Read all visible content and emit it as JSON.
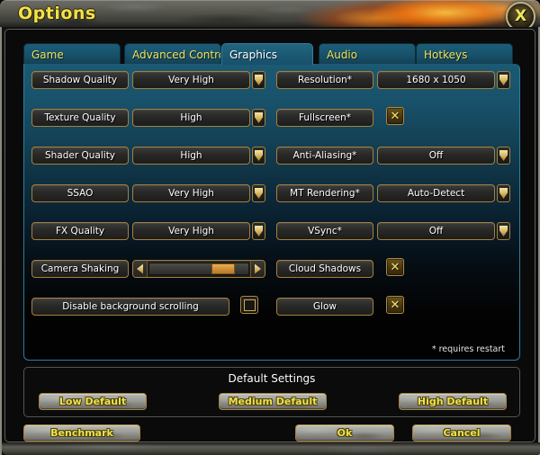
{
  "window": {
    "title": "Options",
    "close_label": "X",
    "close_icon": "close-x-icon"
  },
  "tabs": [
    {
      "label": "Game",
      "active": false
    },
    {
      "label": "Advanced Controls",
      "active": false
    },
    {
      "label": "Graphics",
      "active": true
    },
    {
      "label": "Audio",
      "active": false
    },
    {
      "label": "Hotkeys",
      "active": false
    }
  ],
  "settings": {
    "left_column": [
      {
        "label": "Shadow Quality",
        "control": "dropdown",
        "value": "Very High"
      },
      {
        "label": "Texture Quality",
        "control": "dropdown",
        "value": "High"
      },
      {
        "label": "Shader Quality",
        "control": "dropdown",
        "value": "High"
      },
      {
        "label": "SSAO",
        "control": "dropdown",
        "value": "Very High"
      },
      {
        "label": "FX Quality",
        "control": "dropdown",
        "value": "Very High"
      },
      {
        "label": "Camera Shaking",
        "control": "slider",
        "value": 86
      },
      {
        "label": "Disable background scrolling",
        "control": "checkbox-outline",
        "checked": false
      }
    ],
    "right_column": [
      {
        "label": "Resolution*",
        "control": "dropdown",
        "value": "1680 x 1050"
      },
      {
        "label": "Fullscreen*",
        "control": "checkbox",
        "checked": true,
        "mark": "✕"
      },
      {
        "label": "Anti-Aliasing*",
        "control": "dropdown",
        "value": "Off"
      },
      {
        "label": "MT Rendering*",
        "control": "dropdown",
        "value": "Auto-Detect"
      },
      {
        "label": "VSync*",
        "control": "dropdown",
        "value": "Off"
      },
      {
        "label": "Cloud Shadows",
        "control": "checkbox",
        "checked": true,
        "mark": "✕"
      },
      {
        "label": "Glow",
        "control": "checkbox",
        "checked": true,
        "mark": "✕"
      }
    ],
    "restart_note": "* requires restart"
  },
  "defaults": {
    "title": "Default Settings",
    "low": "Low Default",
    "medium": "Medium Default",
    "high": "High Default"
  },
  "footer": {
    "benchmark": "Benchmark",
    "ok": "Ok",
    "cancel": "Cancel"
  },
  "colors": {
    "accent_gold": "#a5813c",
    "title_yellow": "#f2e14a",
    "panel_teal": "#1b5a74",
    "tab_active_text": "#ffffff"
  }
}
